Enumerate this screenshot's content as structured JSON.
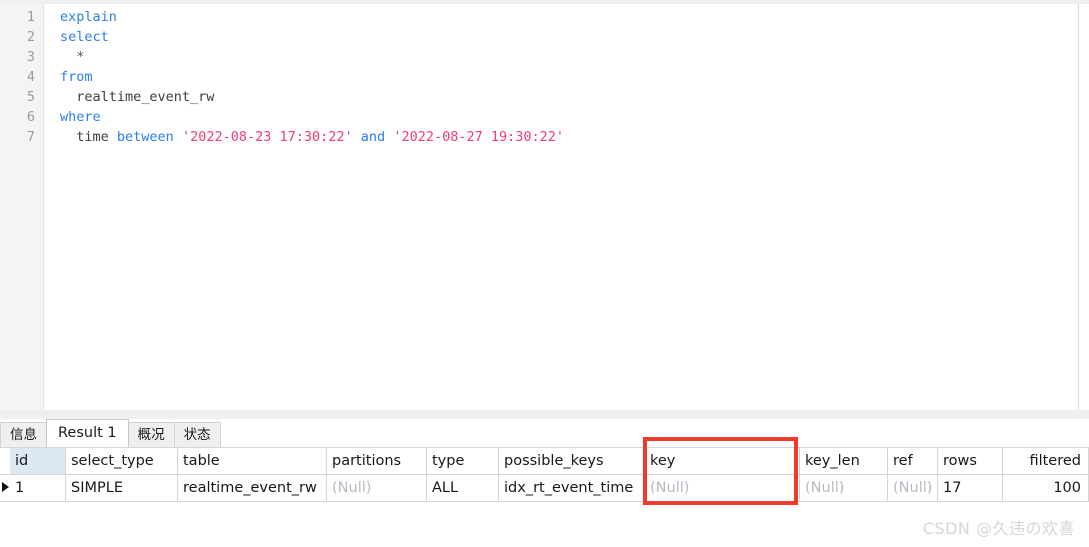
{
  "editor": {
    "language": "sql",
    "line_numbers": [
      "1",
      "2",
      "3",
      "4",
      "5",
      "6",
      "7"
    ],
    "lines": [
      {
        "n": "1",
        "tokens": [
          {
            "t": "explain",
            "c": "kw"
          }
        ]
      },
      {
        "n": "2",
        "tokens": [
          {
            "t": "select",
            "c": "kw"
          }
        ]
      },
      {
        "n": "3",
        "tokens": [
          {
            "t": "  *",
            "c": "op"
          }
        ]
      },
      {
        "n": "4",
        "tokens": [
          {
            "t": "from",
            "c": "kw"
          }
        ]
      },
      {
        "n": "5",
        "tokens": [
          {
            "t": "  realtime_event_rw",
            "c": "ident"
          }
        ]
      },
      {
        "n": "6",
        "tokens": [
          {
            "t": "where",
            "c": "kw"
          }
        ]
      },
      {
        "n": "7",
        "tokens": [
          {
            "t": "  time ",
            "c": "ident"
          },
          {
            "t": "between",
            "c": "kw"
          },
          {
            "t": " ",
            "c": "ident"
          },
          {
            "t": "'2022-08-23 17:30:22'",
            "c": "str"
          },
          {
            "t": " ",
            "c": "ident"
          },
          {
            "t": "and",
            "c": "kw"
          },
          {
            "t": " ",
            "c": "ident"
          },
          {
            "t": "'2022-08-27 19:30:22'",
            "c": "str"
          }
        ]
      }
    ],
    "full_text": "explain\nselect\n  *\nfrom\n  realtime_event_rw\nwhere\n  time between '2022-08-23 17:30:22' and '2022-08-27 19:30:22'"
  },
  "tabs": [
    {
      "label": "信息",
      "active": false
    },
    {
      "label": "Result 1",
      "active": true
    },
    {
      "label": "概况",
      "active": false
    },
    {
      "label": "状态",
      "active": false
    }
  ],
  "result_grid": {
    "columns": [
      "id",
      "select_type",
      "table",
      "partitions",
      "type",
      "possible_keys",
      "key",
      "key_len",
      "ref",
      "rows",
      "filtered"
    ],
    "rows": [
      {
        "id": "1",
        "select_type": "SIMPLE",
        "table": "realtime_event_rw",
        "partitions": "(Null)",
        "type": "ALL",
        "possible_keys": "idx_rt_event_time",
        "key": "(Null)",
        "key_len": "(Null)",
        "ref": "(Null)",
        "rows": "17",
        "filtered": "100"
      }
    ],
    "selected_column": "id",
    "null_text": "(Null)"
  },
  "annotation": {
    "highlight_column": "key",
    "color": "#ef3b2d"
  },
  "watermark": {
    "text": "CSDN @久违の欢喜"
  },
  "colors": {
    "keyword": "#2b7fef",
    "string": "#f13d6e",
    "identifier": "#3d3d3d",
    "null_value": "#b6bcc4",
    "selected_header": "#dce8f4",
    "annotation_red": "#ef3b2d"
  }
}
